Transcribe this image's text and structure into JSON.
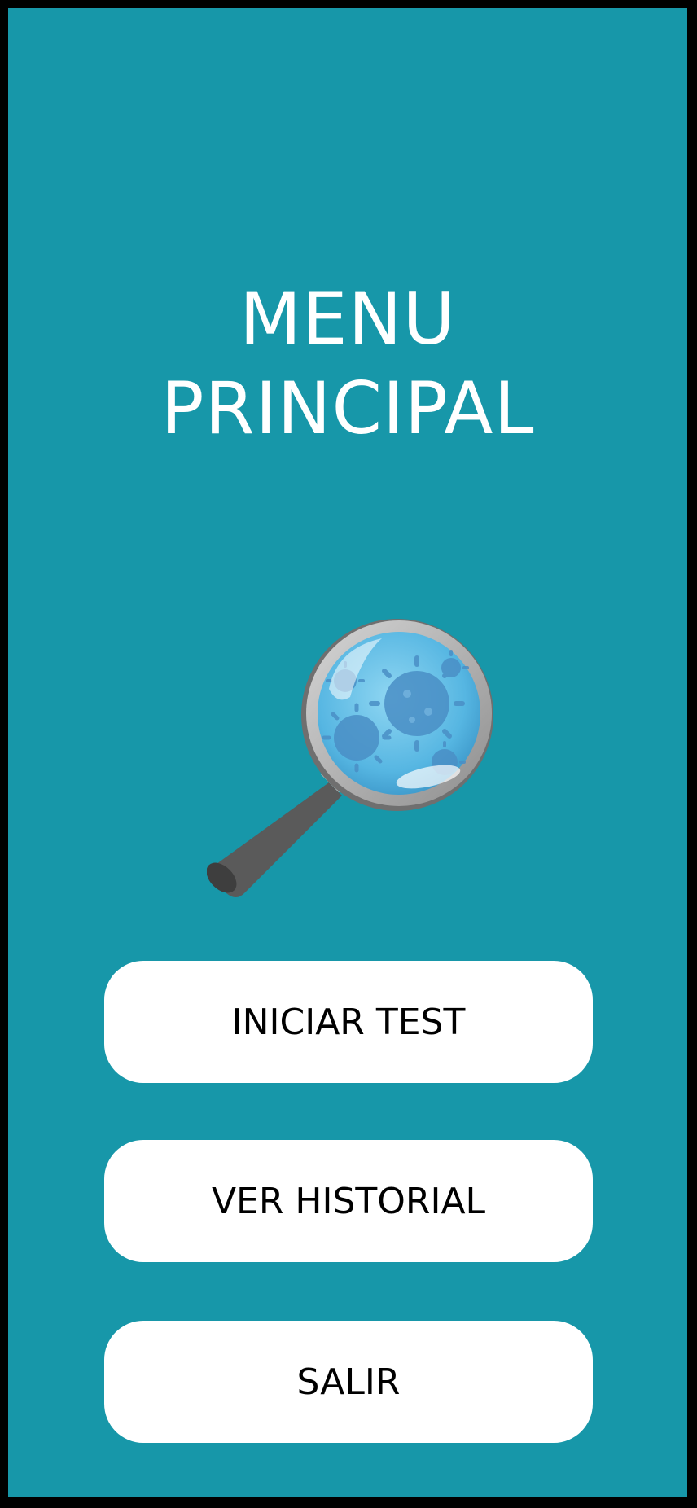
{
  "screen": {
    "title_line1": "MENU",
    "title_line2": "PRINCIPAL",
    "illustration_icon": "magnifying-glass-virus-icon"
  },
  "menu": {
    "start_test_label": "INICIAR TEST",
    "history_label": "VER HISTORIAL",
    "exit_label": "SALIR"
  },
  "colors": {
    "background": "#1797a9",
    "button": "#ffffff",
    "title_text": "#ffffff",
    "button_text": "#000000"
  }
}
